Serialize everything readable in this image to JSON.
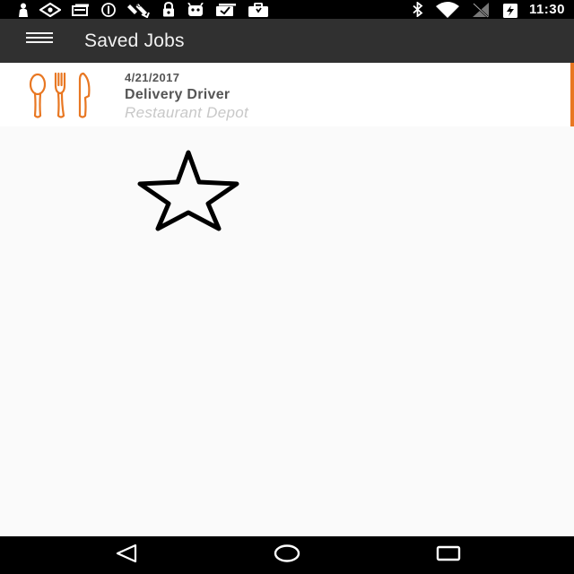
{
  "status_bar": {
    "time": "11:30",
    "left_icons": [
      "person-icon",
      "eye-icon",
      "card-icon",
      "circle-info-icon",
      "satellite-icon",
      "lock-icon",
      "android-icon",
      "checkbox-icon",
      "briefcase-icon"
    ],
    "right_icons": [
      "bluetooth-icon",
      "wifi-icon",
      "no-signal-icon",
      "battery-charging-icon"
    ]
  },
  "app_bar": {
    "menu_icon": "hamburger-menu-icon",
    "title": "Saved Jobs"
  },
  "jobs": [
    {
      "date": "4/21/2017",
      "title": "Delivery Driver",
      "company": "Restaurant Depot",
      "category_icon": "utensils-icon",
      "accent_color": "#e87722"
    }
  ],
  "star": {
    "icon": "star-outline-icon"
  },
  "nav_bar": {
    "buttons": [
      "back-icon",
      "home-icon",
      "recents-icon"
    ]
  },
  "colors": {
    "status_bar": "#000000",
    "app_bar": "#303030",
    "accent": "#e87722",
    "background": "#fafafa"
  }
}
